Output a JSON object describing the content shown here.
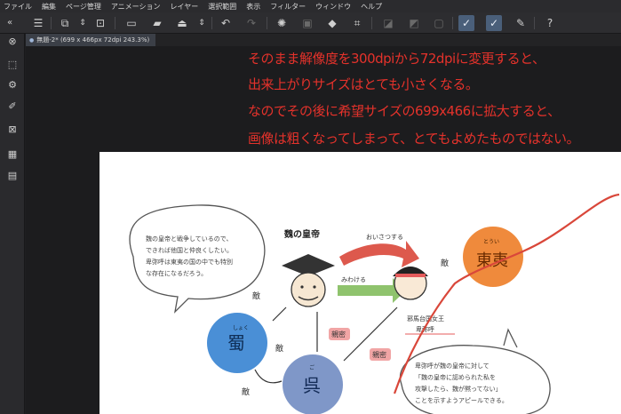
{
  "menu": [
    "ファイル",
    "編集",
    "ページ管理",
    "アニメーション",
    "レイヤー",
    "選択範囲",
    "表示",
    "フィルター",
    "ウィンドウ",
    "ヘルプ"
  ],
  "document_tab": {
    "title": "無題-2* (699 x 466px 72dpi 243.3%)"
  },
  "annotation_lines": [
    "そのまま解像度を300dpiから72dpiに変更すると、",
    "出来上がりサイズはとても小さくなる。",
    "なのでその後に希望サイズの699x466に拡大すると、",
    "画像は粗くなってしまって、とてもよめたものではない。"
  ],
  "illustration": {
    "labels": {
      "teacher_title": "魏の皇帝",
      "arrow_top": "おいさつする",
      "arrow_mid": "みわける",
      "shu": "蜀",
      "shu_ruby": "しょく",
      "wu": "呉",
      "wu_ruby": "ご",
      "dongyi": "東夷",
      "dongyi_ruby": "とうい",
      "enemy1": "敵",
      "enemy2": "敵",
      "enemy3": "敵",
      "enemy4": "敵",
      "friend1": "親密",
      "friend2": "親密",
      "queen_caption_1": "邪馬台国女王",
      "queen_caption_2": "卑弥呼"
    },
    "bubble_left": [
      "魏の皇帝と戦争しているので、",
      "できれば他国と仲良くしたい。",
      "卑弥呼は東夷の国の中でも特別",
      "な存在になるだろう。"
    ],
    "bubble_right": [
      "卑弥呼が魏の皇帝に対して",
      "「魏の皇帝に認められた私を",
      "攻撃したら、魏が黙ってない」",
      "ことを示すようアピールできる。"
    ]
  },
  "colors": {
    "annotation": "#e4322b",
    "shu_circle": "#4a8fd6",
    "wu_circle": "#7f97c8",
    "dongyi_circle": "#ef8a3c",
    "red_arrow": "#d9473a",
    "green_arrow": "#8fc36d",
    "enemy_badge": "#f1a5a5"
  },
  "icons": {
    "toolbar": [
      "menu-icon",
      "layer-icon",
      "stepper-icon",
      "navigator-icon",
      "new-icon",
      "open-icon",
      "save-icon",
      "stepper-icon",
      "undo-icon",
      "redo-icon",
      "loading-icon",
      "fill-icon",
      "bucket-icon",
      "crop-icon",
      "clear-icon",
      "transform-icon",
      "border-icon",
      "pen-active-icon",
      "pen-active-icon",
      "pen-icon",
      "help-icon"
    ]
  }
}
